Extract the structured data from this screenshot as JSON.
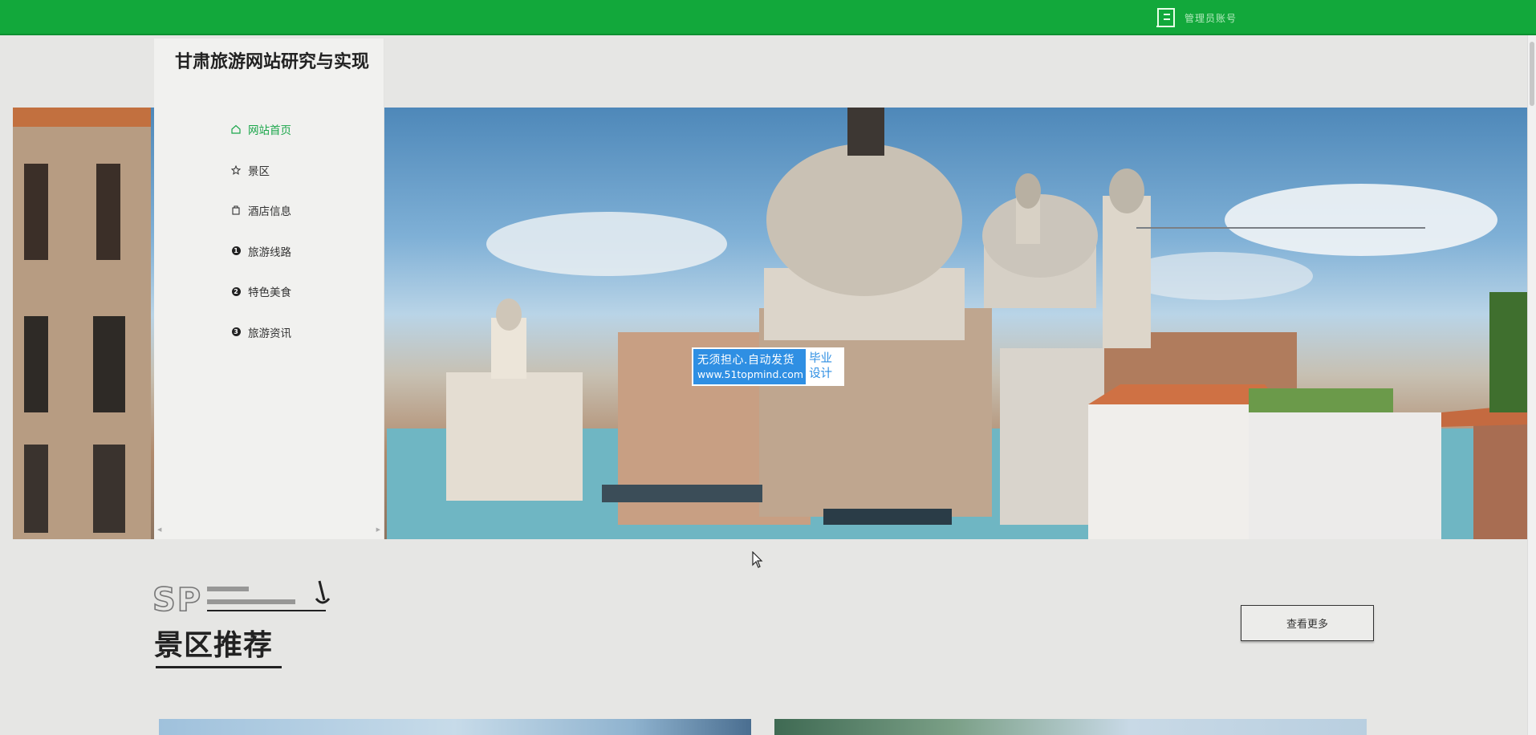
{
  "topbar": {
    "user_text": "管理员账号"
  },
  "sidebar": {
    "title": "甘肃旅游网站研究与实现",
    "menu": [
      {
        "label": "网站首页",
        "icon": "home-icon"
      },
      {
        "label": "景区",
        "icon": "star-icon"
      },
      {
        "label": "酒店信息",
        "icon": "building-icon"
      },
      {
        "label": "旅游线路",
        "icon": "number-1-icon"
      },
      {
        "label": "特色美食",
        "icon": "number-2-icon"
      },
      {
        "label": "旅游资讯",
        "icon": "number-3-icon"
      }
    ]
  },
  "watermark": {
    "line1": "无须担心.自动发货",
    "line2": "www.51topmind.com",
    "right_line1": "毕业",
    "right_line2": "设计"
  },
  "section": {
    "deco_letters": "SP",
    "title": "景区推荐",
    "more_label": "查看更多"
  },
  "colors": {
    "topbar": "#12a83b",
    "active_menu": "#1aa64a",
    "watermark_blue": "#2f8fe3"
  }
}
